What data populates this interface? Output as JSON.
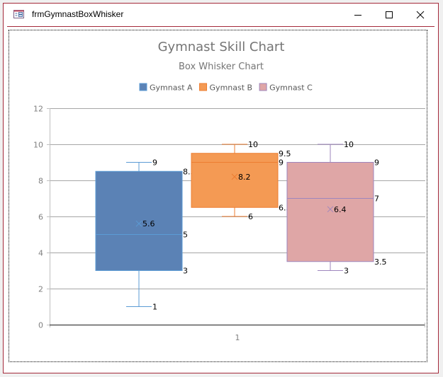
{
  "window": {
    "title": "frmGymnastBoxWhisker",
    "icon": "form-icon",
    "controls": [
      "minimize-icon",
      "maximize-icon",
      "close-icon"
    ]
  },
  "chart_data": {
    "type": "boxplot",
    "title": "Gymnast Skill Chart",
    "subtitle": "Box Whisker Chart",
    "xlabel": "",
    "ylabel": "",
    "ylim": [
      0,
      12
    ],
    "yticks": [
      "0",
      "2",
      "4",
      "6",
      "8",
      "10",
      "12"
    ],
    "ytick_values": [
      0,
      2,
      4,
      6,
      8,
      10,
      12
    ],
    "categories": [
      "1"
    ],
    "grid": true,
    "legend_position": "top",
    "series": [
      {
        "name": "Gymnast A",
        "color": "#5b82b5",
        "edge": "#5b9bd5",
        "min": 1,
        "q1": 3,
        "median": 5,
        "q3": 8.5,
        "max": 9,
        "mean": 5.6,
        "labels": {
          "min": "1",
          "q1": "3",
          "median": "5",
          "q3": "8.5",
          "max": "9",
          "mean": "5.6"
        }
      },
      {
        "name": "Gymnast B",
        "color": "#f49a54",
        "edge": "#ed7d31",
        "min": 6,
        "q1": 6.5,
        "median": 9,
        "q3": 9.5,
        "max": 10,
        "mean": 8.2,
        "labels": {
          "min": "6",
          "q1": "6.5",
          "median": "9",
          "q3": "9.5",
          "max": "10",
          "mean": "8.2"
        }
      },
      {
        "name": "Gymnast C",
        "color": "#dfa6a6",
        "edge": "#9e86bd",
        "min": 3,
        "q1": 3.5,
        "median": 7,
        "q3": 9,
        "max": 10,
        "mean": 6.4,
        "labels": {
          "min": "3",
          "q1": "3.5",
          "median": "7",
          "q3": "9",
          "max": "10",
          "mean": "6.4"
        }
      }
    ]
  }
}
